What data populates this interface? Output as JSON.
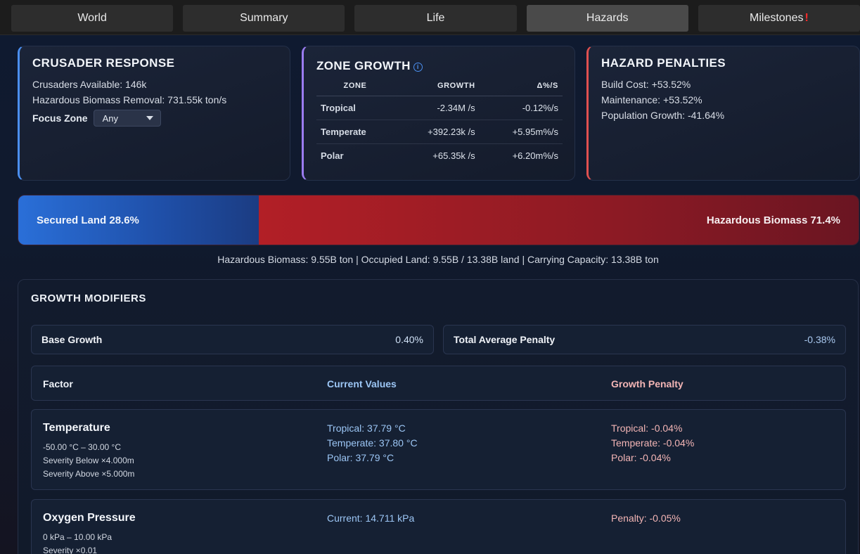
{
  "tabs": [
    {
      "label": "World",
      "active": false
    },
    {
      "label": "Summary",
      "active": false
    },
    {
      "label": "Life",
      "active": false
    },
    {
      "label": "Hazards",
      "active": true
    },
    {
      "label": "Milestones",
      "alert": "!"
    }
  ],
  "crusader": {
    "title": "CRUSADER RESPONSE",
    "available": "Crusaders Available: 146k",
    "removal": "Hazardous Biomass Removal: 731.55k ton/s",
    "focus_label": "Focus Zone",
    "focus_value": "Any"
  },
  "zone_growth": {
    "title": "ZONE GROWTH",
    "columns": [
      "ZONE",
      "GROWTH",
      "Δ%/S"
    ],
    "rows": [
      {
        "zone": "Tropical",
        "growth": "-2.34M /s",
        "delta": "-0.12%/s"
      },
      {
        "zone": "Temperate",
        "growth": "+392.23k /s",
        "delta": "+5.95m%/s"
      },
      {
        "zone": "Polar",
        "growth": "+65.35k /s",
        "delta": "+6.20m%/s"
      }
    ]
  },
  "penalties": {
    "title": "HAZARD PENALTIES",
    "build_cost": "Build Cost: +53.52%",
    "maintenance": "Maintenance: +53.52%",
    "population": "Population Growth: -41.64%"
  },
  "land_bar": {
    "secured_label": "Secured Land 28.6%",
    "hazard_label": "Hazardous Biomass 71.4%",
    "secured_fraction": 0.286,
    "secured_color": "#2a6fd8",
    "hazard_color": "#b21f26"
  },
  "summary_line": "Hazardous Biomass: 9.55B ton | Occupied Land: 9.55B / 13.38B land | Carrying Capacity: 13.38B ton",
  "modifiers": {
    "title": "GROWTH MODIFIERS",
    "base_label": "Base Growth",
    "base_value": "0.40%",
    "avg_label": "Total Average Penalty",
    "avg_value": "-0.38%",
    "headers": {
      "factor": "Factor",
      "current": "Current Values",
      "penalty": "Growth Penalty"
    },
    "temperature": {
      "name": "Temperature",
      "range": "-50.00 °C – 30.00 °C",
      "sev_below": "Severity Below ×4.000m",
      "sev_above": "Severity Above ×5.000m",
      "v1": "Tropical: 37.79 °C",
      "v2": "Temperate: 37.80 °C",
      "v3": "Polar: 37.79 °C",
      "p1": "Tropical: -0.04%",
      "p2": "Temperate: -0.04%",
      "p3": "Polar: -0.04%"
    },
    "oxygen": {
      "name": "Oxygen Pressure",
      "range": "0 kPa – 10.00 kPa",
      "severity": "Severity ×0.01",
      "current": "Current: 14.711 kPa",
      "penalty": "Penalty: -0.05%"
    }
  }
}
